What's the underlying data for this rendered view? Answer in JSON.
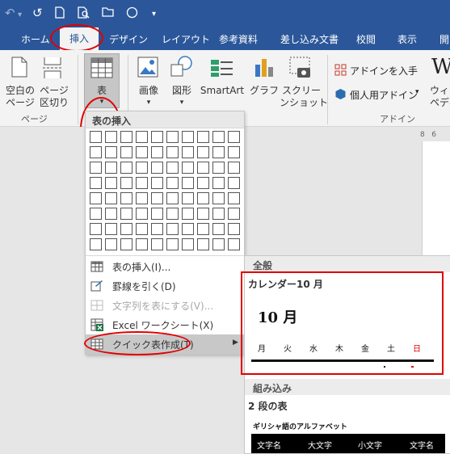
{
  "qat": {
    "undo": "↶",
    "redo": "↺",
    "new": "🗋",
    "preview": "⎙",
    "open": "📂",
    "circle": "○",
    "more": "▾"
  },
  "tabs": [
    "ホーム",
    "挿入",
    "デザイン",
    "レイアウト",
    "参考資料",
    "差し込み文書",
    "校閲",
    "表示",
    "開"
  ],
  "ribbon": {
    "blank_page": [
      "空白の",
      "ページ"
    ],
    "page_break": [
      "ページ",
      "区切り"
    ],
    "pages_group": "ページ",
    "table_button": "表",
    "picture": "画像",
    "shapes": "図形",
    "smartart": "SmartArt",
    "chart": "グラフ",
    "screenshot": [
      "スクリー",
      "ンショット"
    ],
    "addin_get": "アドインを入手",
    "addin_personal": "個人用アドイン",
    "wiki": [
      "ウィキ",
      "ペディア"
    ],
    "addin_group": "アドイン",
    "ruler": "8   6"
  },
  "menu": {
    "header": "表の挿入",
    "grid_cols": 10,
    "grid_rows": 8,
    "items": [
      {
        "label": "表の挿入(I)...",
        "icon": "table-insert-icon",
        "disabled": false
      },
      {
        "label": "罫線を引く(D)",
        "icon": "draw-table-icon",
        "disabled": false
      },
      {
        "label": "文字列を表にする(V)...",
        "icon": "text-to-table-icon",
        "disabled": true
      },
      {
        "label": "Excel ワークシート(X)",
        "icon": "excel-icon",
        "disabled": false
      },
      {
        "label": "クイック表作成(T)",
        "icon": "quick-table-icon",
        "disabled": false
      }
    ]
  },
  "submenu": {
    "section1": "全般",
    "cal_title": "カレンダー10 月",
    "cal_month": "10 月",
    "cal_days": [
      "月",
      "火",
      "水",
      "木",
      "金",
      "土",
      "日"
    ],
    "section2": "組み込み",
    "twostep_title": "2 段の表",
    "greek_title": "ギリシャ語のアルファベット",
    "greek_cols": [
      "文字名",
      "大文字",
      "小文字",
      "文字名"
    ]
  },
  "colors": {
    "accent": "#2b579a",
    "highlight": "#e00000",
    "sunday": "#e00000"
  }
}
